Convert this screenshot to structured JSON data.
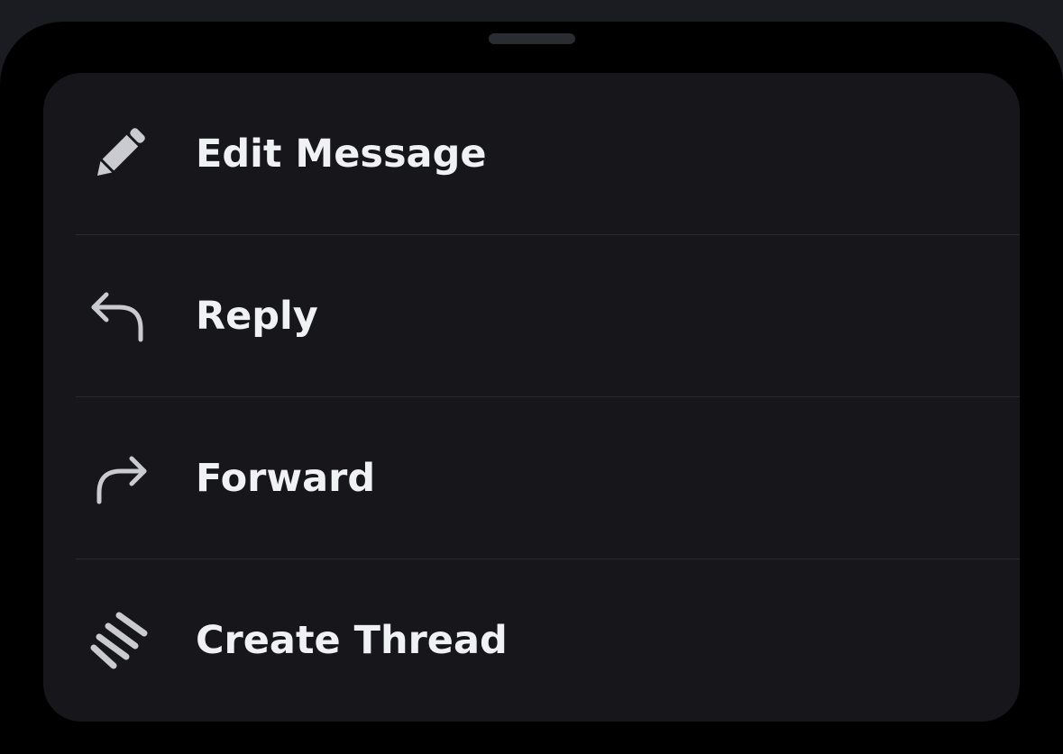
{
  "colors": {
    "backdrop": "#1b1c21",
    "sheet": "#000000",
    "card": "#16161b",
    "divider": "#2a2b30",
    "text": "#f0f1f3",
    "icon": "#c9cbd0"
  },
  "menu": {
    "items": [
      {
        "label": "Edit Message",
        "icon": "pencil-icon"
      },
      {
        "label": "Reply",
        "icon": "reply-arrow-icon"
      },
      {
        "label": "Forward",
        "icon": "forward-arrow-icon"
      },
      {
        "label": "Create Thread",
        "icon": "thread-icon"
      }
    ]
  }
}
